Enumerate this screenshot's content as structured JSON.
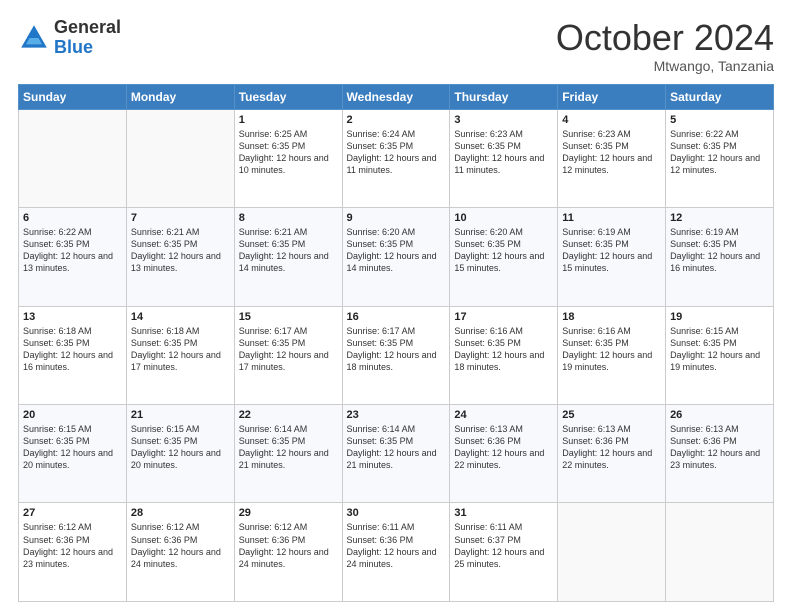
{
  "header": {
    "logo_general": "General",
    "logo_blue": "Blue",
    "month": "October 2024",
    "location": "Mtwango, Tanzania"
  },
  "days_of_week": [
    "Sunday",
    "Monday",
    "Tuesday",
    "Wednesday",
    "Thursday",
    "Friday",
    "Saturday"
  ],
  "weeks": [
    [
      {
        "day": "",
        "sunrise": "",
        "sunset": "",
        "daylight": ""
      },
      {
        "day": "",
        "sunrise": "",
        "sunset": "",
        "daylight": ""
      },
      {
        "day": "1",
        "sunrise": "Sunrise: 6:25 AM",
        "sunset": "Sunset: 6:35 PM",
        "daylight": "Daylight: 12 hours and 10 minutes."
      },
      {
        "day": "2",
        "sunrise": "Sunrise: 6:24 AM",
        "sunset": "Sunset: 6:35 PM",
        "daylight": "Daylight: 12 hours and 11 minutes."
      },
      {
        "day": "3",
        "sunrise": "Sunrise: 6:23 AM",
        "sunset": "Sunset: 6:35 PM",
        "daylight": "Daylight: 12 hours and 11 minutes."
      },
      {
        "day": "4",
        "sunrise": "Sunrise: 6:23 AM",
        "sunset": "Sunset: 6:35 PM",
        "daylight": "Daylight: 12 hours and 12 minutes."
      },
      {
        "day": "5",
        "sunrise": "Sunrise: 6:22 AM",
        "sunset": "Sunset: 6:35 PM",
        "daylight": "Daylight: 12 hours and 12 minutes."
      }
    ],
    [
      {
        "day": "6",
        "sunrise": "Sunrise: 6:22 AM",
        "sunset": "Sunset: 6:35 PM",
        "daylight": "Daylight: 12 hours and 13 minutes."
      },
      {
        "day": "7",
        "sunrise": "Sunrise: 6:21 AM",
        "sunset": "Sunset: 6:35 PM",
        "daylight": "Daylight: 12 hours and 13 minutes."
      },
      {
        "day": "8",
        "sunrise": "Sunrise: 6:21 AM",
        "sunset": "Sunset: 6:35 PM",
        "daylight": "Daylight: 12 hours and 14 minutes."
      },
      {
        "day": "9",
        "sunrise": "Sunrise: 6:20 AM",
        "sunset": "Sunset: 6:35 PM",
        "daylight": "Daylight: 12 hours and 14 minutes."
      },
      {
        "day": "10",
        "sunrise": "Sunrise: 6:20 AM",
        "sunset": "Sunset: 6:35 PM",
        "daylight": "Daylight: 12 hours and 15 minutes."
      },
      {
        "day": "11",
        "sunrise": "Sunrise: 6:19 AM",
        "sunset": "Sunset: 6:35 PM",
        "daylight": "Daylight: 12 hours and 15 minutes."
      },
      {
        "day": "12",
        "sunrise": "Sunrise: 6:19 AM",
        "sunset": "Sunset: 6:35 PM",
        "daylight": "Daylight: 12 hours and 16 minutes."
      }
    ],
    [
      {
        "day": "13",
        "sunrise": "Sunrise: 6:18 AM",
        "sunset": "Sunset: 6:35 PM",
        "daylight": "Daylight: 12 hours and 16 minutes."
      },
      {
        "day": "14",
        "sunrise": "Sunrise: 6:18 AM",
        "sunset": "Sunset: 6:35 PM",
        "daylight": "Daylight: 12 hours and 17 minutes."
      },
      {
        "day": "15",
        "sunrise": "Sunrise: 6:17 AM",
        "sunset": "Sunset: 6:35 PM",
        "daylight": "Daylight: 12 hours and 17 minutes."
      },
      {
        "day": "16",
        "sunrise": "Sunrise: 6:17 AM",
        "sunset": "Sunset: 6:35 PM",
        "daylight": "Daylight: 12 hours and 18 minutes."
      },
      {
        "day": "17",
        "sunrise": "Sunrise: 6:16 AM",
        "sunset": "Sunset: 6:35 PM",
        "daylight": "Daylight: 12 hours and 18 minutes."
      },
      {
        "day": "18",
        "sunrise": "Sunrise: 6:16 AM",
        "sunset": "Sunset: 6:35 PM",
        "daylight": "Daylight: 12 hours and 19 minutes."
      },
      {
        "day": "19",
        "sunrise": "Sunrise: 6:15 AM",
        "sunset": "Sunset: 6:35 PM",
        "daylight": "Daylight: 12 hours and 19 minutes."
      }
    ],
    [
      {
        "day": "20",
        "sunrise": "Sunrise: 6:15 AM",
        "sunset": "Sunset: 6:35 PM",
        "daylight": "Daylight: 12 hours and 20 minutes."
      },
      {
        "day": "21",
        "sunrise": "Sunrise: 6:15 AM",
        "sunset": "Sunset: 6:35 PM",
        "daylight": "Daylight: 12 hours and 20 minutes."
      },
      {
        "day": "22",
        "sunrise": "Sunrise: 6:14 AM",
        "sunset": "Sunset: 6:35 PM",
        "daylight": "Daylight: 12 hours and 21 minutes."
      },
      {
        "day": "23",
        "sunrise": "Sunrise: 6:14 AM",
        "sunset": "Sunset: 6:35 PM",
        "daylight": "Daylight: 12 hours and 21 minutes."
      },
      {
        "day": "24",
        "sunrise": "Sunrise: 6:13 AM",
        "sunset": "Sunset: 6:36 PM",
        "daylight": "Daylight: 12 hours and 22 minutes."
      },
      {
        "day": "25",
        "sunrise": "Sunrise: 6:13 AM",
        "sunset": "Sunset: 6:36 PM",
        "daylight": "Daylight: 12 hours and 22 minutes."
      },
      {
        "day": "26",
        "sunrise": "Sunrise: 6:13 AM",
        "sunset": "Sunset: 6:36 PM",
        "daylight": "Daylight: 12 hours and 23 minutes."
      }
    ],
    [
      {
        "day": "27",
        "sunrise": "Sunrise: 6:12 AM",
        "sunset": "Sunset: 6:36 PM",
        "daylight": "Daylight: 12 hours and 23 minutes."
      },
      {
        "day": "28",
        "sunrise": "Sunrise: 6:12 AM",
        "sunset": "Sunset: 6:36 PM",
        "daylight": "Daylight: 12 hours and 24 minutes."
      },
      {
        "day": "29",
        "sunrise": "Sunrise: 6:12 AM",
        "sunset": "Sunset: 6:36 PM",
        "daylight": "Daylight: 12 hours and 24 minutes."
      },
      {
        "day": "30",
        "sunrise": "Sunrise: 6:11 AM",
        "sunset": "Sunset: 6:36 PM",
        "daylight": "Daylight: 12 hours and 24 minutes."
      },
      {
        "day": "31",
        "sunrise": "Sunrise: 6:11 AM",
        "sunset": "Sunset: 6:37 PM",
        "daylight": "Daylight: 12 hours and 25 minutes."
      },
      {
        "day": "",
        "sunrise": "",
        "sunset": "",
        "daylight": ""
      },
      {
        "day": "",
        "sunrise": "",
        "sunset": "",
        "daylight": ""
      }
    ]
  ]
}
